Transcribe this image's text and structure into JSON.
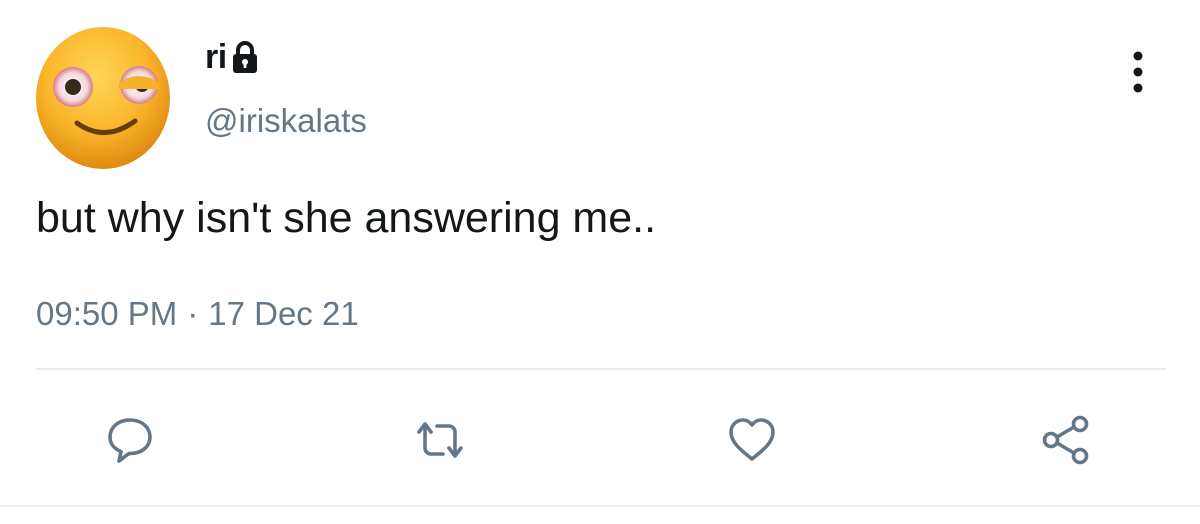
{
  "tweet": {
    "display_name": "ri",
    "handle": "@iriskalats",
    "text": "but why isn't she answering me..",
    "time": "09:50 PM",
    "separator": "·",
    "date": "17 Dec 21"
  },
  "icons": {
    "avatar": "flushed-smiling-face-emoji",
    "protected": "lock-icon",
    "more": "more-vertical-icon",
    "reply": "reply-icon",
    "retweet": "retweet-icon",
    "like": "heart-icon",
    "share": "share-icon"
  },
  "colors": {
    "text": "#14171a",
    "secondary": "#657786",
    "icon": "#657786",
    "divider": "#e6ecf0",
    "avatar_face": "#f6b62b"
  }
}
